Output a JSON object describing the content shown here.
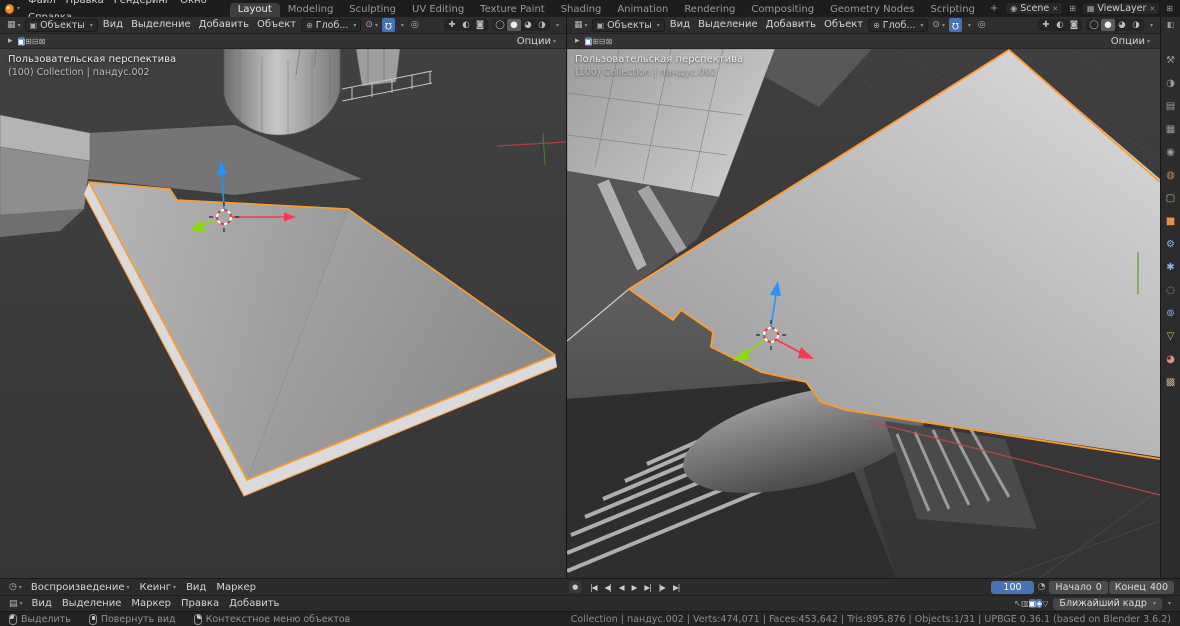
{
  "icons": {
    "dropdown": "▾",
    "editor_3d_viewport": "▦",
    "editor_timeline": "◷",
    "editor_dopesheet": "▤",
    "editor_properties": "◧",
    "object_mode": "▣",
    "orientation_globe": "⊕",
    "pivot": "⊙",
    "magnet": "Ω",
    "proportional": "◎",
    "tool_expand": "▸",
    "scene_small": "◉",
    "viewlayer_small": "▦",
    "new_datablock": "⊞",
    "close": "✕",
    "record": "●",
    "clock": "◔"
  },
  "topbar": {
    "app_menus": [
      "Файл",
      "Правка",
      "Рендеринг",
      "Окно",
      "Справка"
    ],
    "workspaces": [
      {
        "label": "Layout",
        "active": true
      },
      {
        "label": "Modeling"
      },
      {
        "label": "Sculpting"
      },
      {
        "label": "UV Editing"
      },
      {
        "label": "Texture Paint"
      },
      {
        "label": "Shading"
      },
      {
        "label": "Animation"
      },
      {
        "label": "Rendering"
      },
      {
        "label": "Compositing"
      },
      {
        "label": "Geometry Nodes"
      },
      {
        "label": "Scripting"
      }
    ],
    "new_workspace": "+",
    "scene_label": "Scene",
    "view_layer_label": "ViewLayer"
  },
  "viewport_header": {
    "mode": "Объекты",
    "menus": [
      "Вид",
      "Выделение",
      "Добавить",
      "Объект"
    ],
    "orientation": "Глоб...",
    "view_toggles": [
      {
        "name": "show-gizmo-toggle",
        "glyph": "✚"
      },
      {
        "name": "show-overlays-toggle",
        "glyph": "◐"
      },
      {
        "name": "toggle-xray",
        "glyph": "◙"
      }
    ],
    "shading_modes": [
      {
        "name": "shading-wireframe",
        "glyph": "◯"
      },
      {
        "name": "shading-solid",
        "glyph": "●",
        "active": true
      },
      {
        "name": "shading-material-preview",
        "glyph": "◕"
      },
      {
        "name": "shading-rendered",
        "glyph": "◑"
      }
    ],
    "select_tool_icons": [
      {
        "name": "select-mode-new",
        "glyph": "▣",
        "active": true
      },
      {
        "name": "select-mode-extend",
        "glyph": "⊞"
      },
      {
        "name": "select-mode-subtract",
        "glyph": "⊟"
      },
      {
        "name": "select-mode-invert",
        "glyph": "⊠"
      }
    ],
    "options_label": "Опции"
  },
  "viewports": {
    "left_overlay": {
      "line1": "Пользовательская перспектива",
      "line2": "(100) Collection | пандус.002"
    },
    "right_overlay": {
      "line1": "Пользовательская перспектива",
      "line2": "(100) Collection | пандус.002"
    }
  },
  "properties_tabs": [
    {
      "name": "tab-tool",
      "glyph": "⚒",
      "color": "#9a9a9a"
    },
    {
      "name": "tab-render",
      "glyph": "◑",
      "color": "#9a9a9a"
    },
    {
      "name": "tab-output",
      "glyph": "▤",
      "color": "#9a9a9a"
    },
    {
      "name": "tab-view-layer",
      "glyph": "▦",
      "color": "#9a9a9a"
    },
    {
      "name": "tab-scene",
      "glyph": "◉",
      "color": "#9a9a9a"
    },
    {
      "name": "tab-world",
      "glyph": "◍",
      "color": "#c08a5a"
    },
    {
      "name": "tab-collection",
      "glyph": "▢",
      "color": "#cfae84"
    },
    {
      "name": "tab-object",
      "glyph": "■",
      "color": "#e8923c"
    },
    {
      "name": "tab-modifiers",
      "glyph": "⚙",
      "color": "#8db8e8"
    },
    {
      "name": "tab-particles",
      "glyph": "✱",
      "color": "#8db8e8"
    },
    {
      "name": "tab-physics",
      "glyph": "◌",
      "color": "#8db8e8"
    },
    {
      "name": "tab-constraints",
      "glyph": "⊚",
      "color": "#8db8e8"
    },
    {
      "name": "tab-object-data",
      "glyph": "▽",
      "color": "#8ecf6e"
    },
    {
      "name": "tab-material",
      "glyph": "◕",
      "color": "#e88a8a"
    },
    {
      "name": "tab-texture",
      "glyph": "▩",
      "color": "#d8a07a"
    }
  ],
  "timeline": {
    "menus": [
      {
        "label": "Воспроизведение",
        "dropdown": true
      },
      {
        "label": "Кеинг",
        "dropdown": true
      },
      {
        "label": "Вид"
      },
      {
        "label": "Маркер"
      }
    ],
    "playback": [
      {
        "name": "jump-to-start-button",
        "glyph": "|◀"
      },
      {
        "name": "prev-keyframe-button",
        "glyph": "◀|"
      },
      {
        "name": "play-reverse-button",
        "glyph": "◀"
      },
      {
        "name": "play-button",
        "glyph": "▶"
      },
      {
        "name": "next-frame-button",
        "glyph": "▶|"
      },
      {
        "name": "next-keyframe-button",
        "glyph": "|▶"
      },
      {
        "name": "jump-to-end-button",
        "glyph": "▶|"
      }
    ],
    "current_frame": "100",
    "start_label": "Начало",
    "start_value": "0",
    "end_label": "Конец",
    "end_value": "400"
  },
  "dopesheet": {
    "menus": [
      "Вид",
      "Выделение",
      "Маркер",
      "Правка",
      "Добавить"
    ],
    "filter_icons": [
      {
        "name": "only-selected-filter",
        "glyph": "↖"
      },
      {
        "name": "show-hidden-filter",
        "glyph": "▥"
      },
      {
        "name": "filter-toggle-a",
        "glyph": "▣",
        "active": true
      },
      {
        "name": "filter-toggle-b",
        "glyph": "◈",
        "active": true
      },
      {
        "name": "filter-funnel",
        "glyph": "▽"
      }
    ],
    "snap_label": "Ближайший кадр"
  },
  "statusbar": {
    "hints": [
      {
        "label": "Выделить"
      },
      {
        "label": "Повернуть вид"
      },
      {
        "label": "Контекстное меню объектов"
      }
    ],
    "stats": "Collection | пандус.002 | Verts:474,071 | Faces:453,642 | Tris:895,876 | Objects:1/31 | UPBGE 0.36.1 (based on Blender 3.6.2)"
  }
}
